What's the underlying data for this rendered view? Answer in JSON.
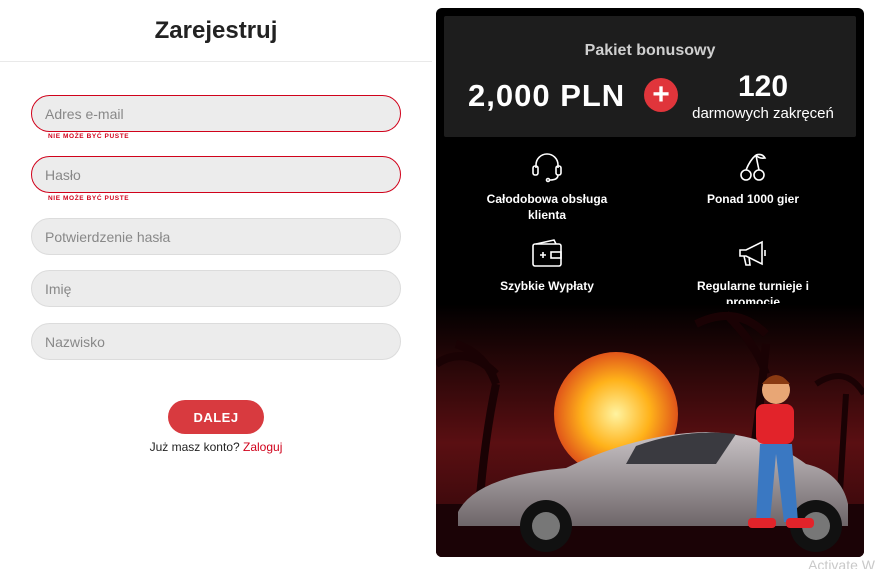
{
  "form": {
    "title": "Zarejestruj",
    "email_placeholder": "Adres e-mail",
    "email_error": "NIE MOŻE BYĆ PUSTE",
    "password_placeholder": "Hasło",
    "password_error": "NIE MOŻE BYĆ PUSTE",
    "confirm_placeholder": "Potwierdzenie hasła",
    "first_name_placeholder": "Imię",
    "last_name_placeholder": "Nazwisko",
    "next_label": "DALEJ",
    "login_prompt": "Już masz konto?",
    "login_link": "Zaloguj"
  },
  "promo": {
    "bonus_title": "Pakiet bonusowy",
    "amount": "2,000 PLN",
    "plus": "+",
    "spins_count": "120",
    "spins_label": "darmowych zakręceń",
    "features": [
      {
        "icon": "headset-icon",
        "text": "Całodobowa obsługa klienta"
      },
      {
        "icon": "cherries-icon",
        "text": "Ponad 1000 gier"
      },
      {
        "icon": "wallet-icon",
        "text": "Szybkie Wypłaty"
      },
      {
        "icon": "megaphone-icon",
        "text": "Regularne turnieje i promocje"
      }
    ]
  },
  "colors": {
    "accent": "#d83a3f",
    "error": "#d0021b",
    "panel": "#000000",
    "bonus_box": "#1d1d1d"
  },
  "watermark": "Activate W"
}
